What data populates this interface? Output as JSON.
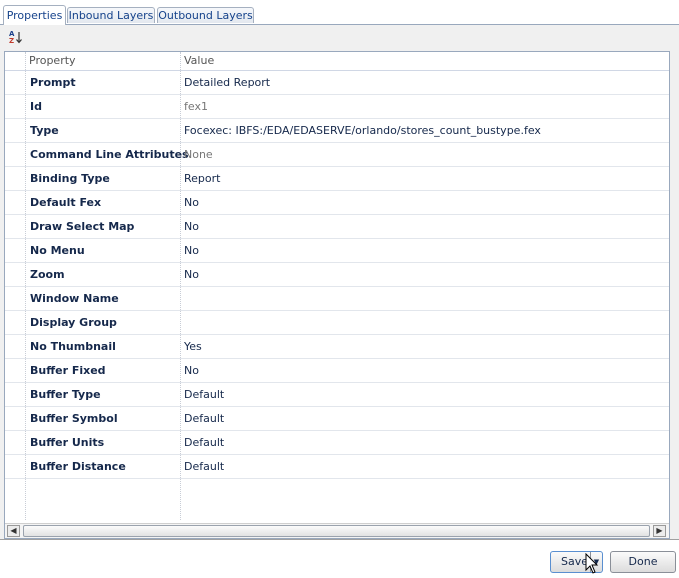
{
  "tabs": [
    {
      "label": "Properties",
      "active": true
    },
    {
      "label": "Inbound Layers",
      "active": false
    },
    {
      "label": "Outbound Layers",
      "active": false
    }
  ],
  "toolbar": {
    "sort_icon": "sort-az-icon"
  },
  "grid": {
    "columns": [
      "Property",
      "Value"
    ],
    "rows": [
      {
        "property": "Prompt",
        "value": "Detailed Report"
      },
      {
        "property": "Id",
        "value": "fex1"
      },
      {
        "property": "Type",
        "value": "Focexec: IBFS:/EDA/EDASERVE/orlando/stores_count_bustype.fex"
      },
      {
        "property": "Command Line Attributes",
        "value": "None"
      },
      {
        "property": "Binding Type",
        "value": "Report"
      },
      {
        "property": "Default Fex",
        "value": "No"
      },
      {
        "property": "Draw Select Map",
        "value": "No"
      },
      {
        "property": "No Menu",
        "value": "No"
      },
      {
        "property": "Zoom",
        "value": "No"
      },
      {
        "property": "Window Name",
        "value": ""
      },
      {
        "property": "Display Group",
        "value": ""
      },
      {
        "property": "No Thumbnail",
        "value": "Yes"
      },
      {
        "property": "Buffer Fixed",
        "value": "No"
      },
      {
        "property": "Buffer Type",
        "value": "Default"
      },
      {
        "property": "Buffer Symbol",
        "value": "Default"
      },
      {
        "property": "Buffer Units",
        "value": "Default"
      },
      {
        "property": "Buffer Distance",
        "value": "Default"
      }
    ]
  },
  "buttons": {
    "save_label": "Save",
    "done_label": "Done"
  },
  "colors": {
    "accent": "#15428b",
    "text": "#15284b",
    "panel": "#f0f0f0"
  }
}
